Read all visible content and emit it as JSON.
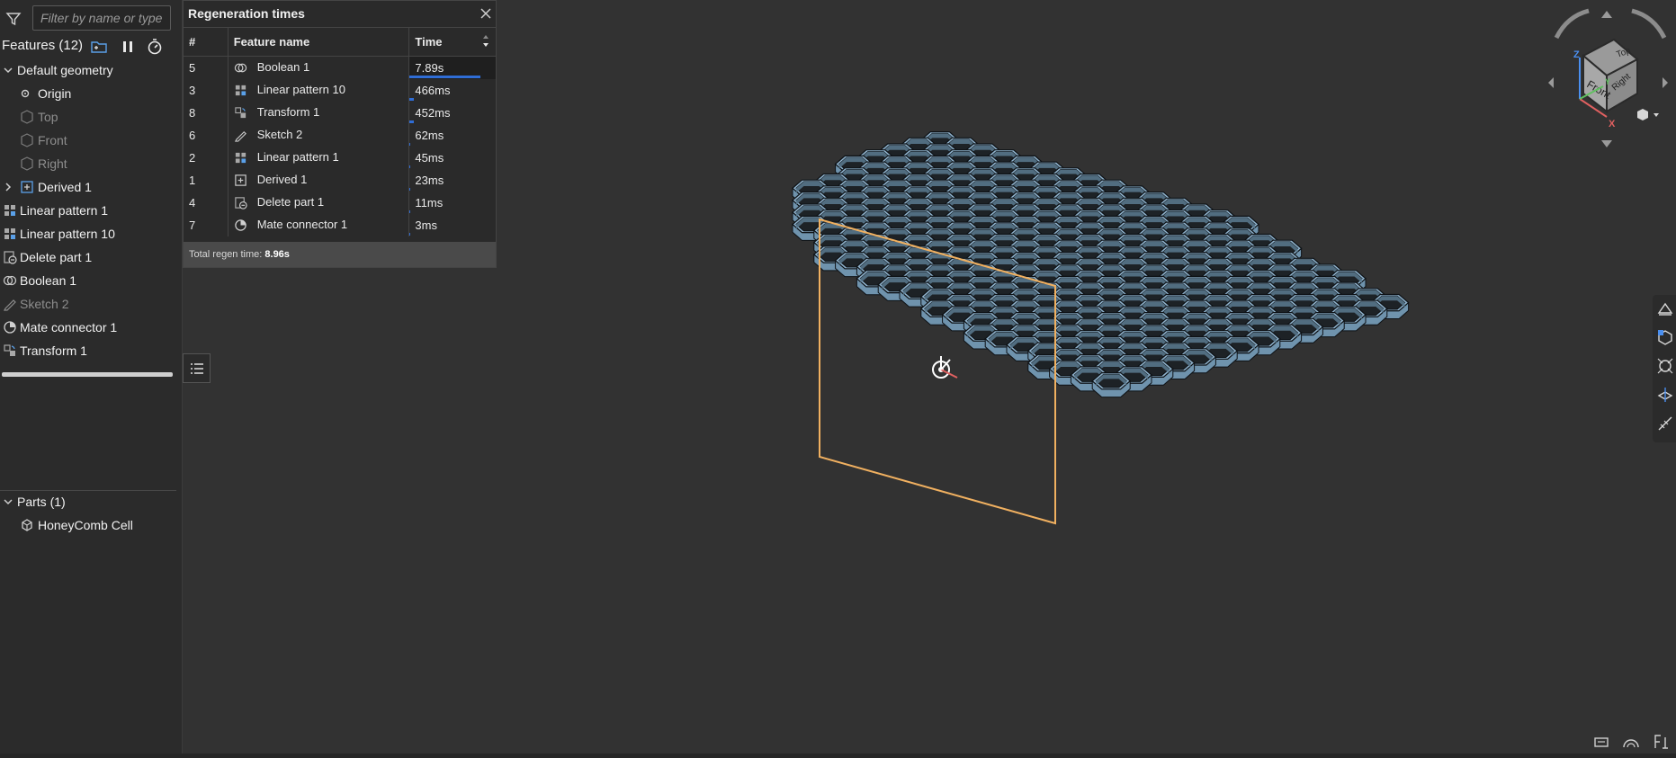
{
  "filter": {
    "placeholder": "Filter by name or type"
  },
  "features": {
    "title": "Features (12)",
    "default_geometry": "Default geometry",
    "origin": "Origin",
    "top": "Top",
    "front": "Front",
    "right": "Right",
    "items": [
      {
        "label": "Derived 1",
        "icon": "derived-icon"
      },
      {
        "label": "Linear pattern 1",
        "icon": "linear-pattern-icon"
      },
      {
        "label": "Linear pattern 10",
        "icon": "linear-pattern-icon"
      },
      {
        "label": "Delete part 1",
        "icon": "delete-part-icon"
      },
      {
        "label": "Boolean 1",
        "icon": "boolean-icon"
      },
      {
        "label": "Sketch 2",
        "icon": "sketch-icon"
      },
      {
        "label": "Mate connector 1",
        "icon": "mate-connector-icon"
      },
      {
        "label": "Transform 1",
        "icon": "transform-icon"
      }
    ]
  },
  "parts": {
    "title": "Parts (1)",
    "items": [
      {
        "label": "HoneyComb Cell",
        "icon": "part-icon"
      }
    ]
  },
  "regen": {
    "title": "Regeneration times",
    "columns": {
      "num": "#",
      "name": "Feature name",
      "time": "Time"
    },
    "rows": [
      {
        "num": "5",
        "name": "Boolean 1",
        "time": "7.89s",
        "fraction": 0.88,
        "icon": "boolean-icon"
      },
      {
        "num": "3",
        "name": "Linear pattern 10",
        "time": "466ms",
        "fraction": 0.05,
        "icon": "linear-pattern-icon"
      },
      {
        "num": "8",
        "name": "Transform 1",
        "time": "452ms",
        "fraction": 0.05,
        "icon": "transform-icon"
      },
      {
        "num": "6",
        "name": "Sketch 2",
        "time": "62ms",
        "fraction": 0.007,
        "icon": "sketch-icon"
      },
      {
        "num": "2",
        "name": "Linear pattern 1",
        "time": "45ms",
        "fraction": 0.005,
        "icon": "linear-pattern-icon"
      },
      {
        "num": "1",
        "name": "Derived 1",
        "time": "23ms",
        "fraction": 0.003,
        "icon": "derived-icon"
      },
      {
        "num": "4",
        "name": "Delete part 1",
        "time": "11ms",
        "fraction": 0.001,
        "icon": "delete-part-icon"
      },
      {
        "num": "7",
        "name": "Mate connector 1",
        "time": "3ms",
        "fraction": 0.0003,
        "icon": "mate-connector-icon"
      }
    ],
    "footer_label": "Total regen time:",
    "footer_value": "8.96s"
  },
  "view_cube": {
    "top": "Top",
    "front": "Front",
    "right": "Right",
    "x": "X",
    "y": "Y",
    "z": "Z"
  },
  "colors": {
    "accent": "#2f6dd6",
    "cell_top": "#8fb2cc",
    "cell_side": "#6f93ad",
    "cell_edge": "#0e1216",
    "plane": "#f0b060",
    "background": "#323232"
  }
}
